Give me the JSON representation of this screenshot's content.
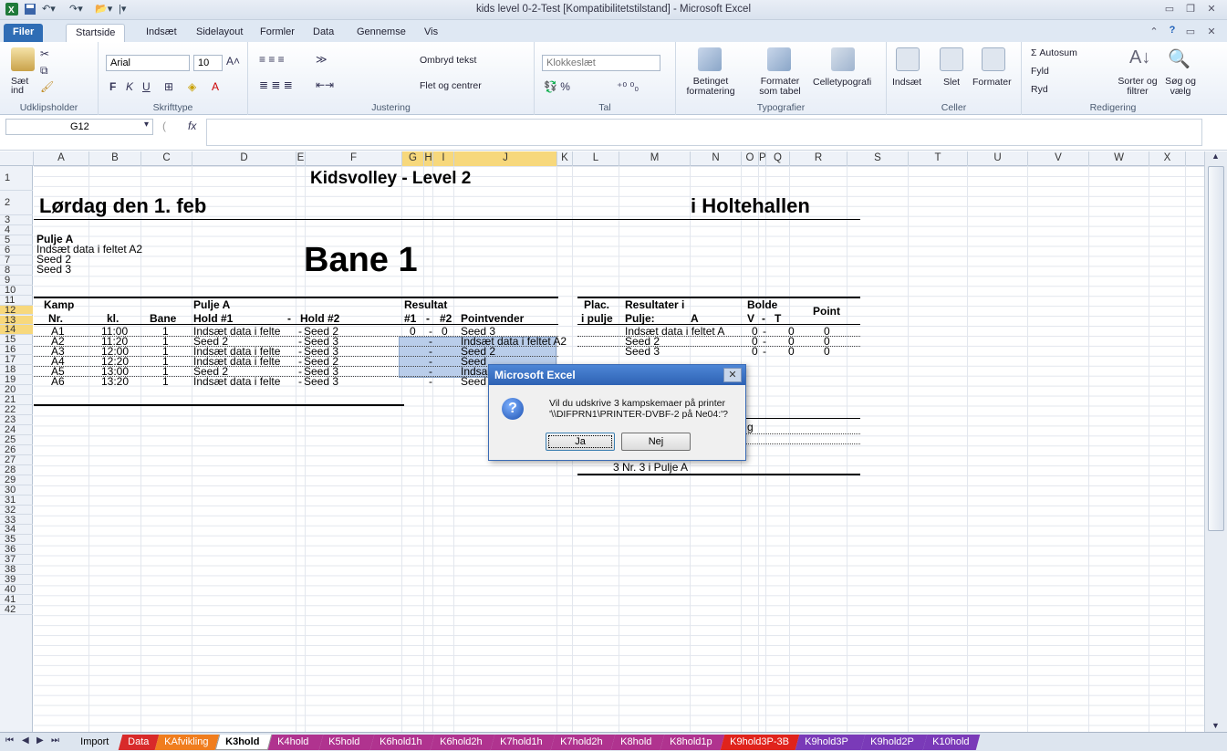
{
  "window": {
    "title": "kids level 0-2-Test  [Kompatibilitetstilstand]  -  Microsoft Excel"
  },
  "tabs": [
    "Filer",
    "Startside",
    "Indsæt",
    "Sidelayout",
    "Formler",
    "Data",
    "Gennemse",
    "Vis"
  ],
  "ribbon": {
    "clipboard": {
      "paste": "Sæt ind",
      "label": "Udklipsholder"
    },
    "font": {
      "name": "Arial",
      "size": "10",
      "label": "Skrifttype"
    },
    "align": {
      "wrap": "Ombryd tekst",
      "merge": "Flet og centrer",
      "label": "Justering"
    },
    "number": {
      "format": "Klokkeslæt",
      "label": "Tal"
    },
    "styles": {
      "cond": "Betinget formatering",
      "table": "Formater som tabel",
      "cell": "Celletypografi",
      "label": "Typografier"
    },
    "cells": {
      "insert": "Indsæt",
      "delete": "Slet",
      "format": "Formater",
      "label": "Celler"
    },
    "editing": {
      "autosum": "Σ Autosum",
      "fill": "Fyld",
      "clear": "Ryd",
      "sort": "Sorter og filtrer",
      "find": "Søg og vælg",
      "label": "Redigering"
    }
  },
  "formula": {
    "cell": "G12",
    "fx": "fx"
  },
  "columns": [
    "A",
    "B",
    "C",
    "D",
    "E",
    "F",
    "G",
    "H",
    "I",
    "J",
    "K",
    "L",
    "M",
    "N",
    "O",
    "P",
    "Q",
    "R",
    "S",
    "T",
    "U",
    "V",
    "W",
    "X"
  ],
  "rows": [
    "1",
    "2",
    "3",
    "4",
    "5",
    "6",
    "7",
    "8",
    "9",
    "10",
    "11",
    "12",
    "13",
    "14",
    "15",
    "16",
    "17",
    "18",
    "19",
    "20",
    "21",
    "22",
    "23",
    "24",
    "25",
    "26",
    "27",
    "28",
    "29",
    "30",
    "31",
    "32",
    "33",
    "34",
    "35",
    "36",
    "37",
    "38",
    "39",
    "40",
    "41",
    "42"
  ],
  "sheet": {
    "title": "Kidsvolley   -   Level 2",
    "date": "Lørdag den 1. feb",
    "place": "i  Holtehallen",
    "court": "Bane 1",
    "pool": "Pulje A",
    "pool_lines": [
      "Indsæt data i feltet A2",
      "Seed 2",
      "Seed 3"
    ],
    "hdr1": {
      "kamp": "Kamp",
      "pulje": "Pulje A",
      "resultat": "Resultat",
      "plac": "Plac.",
      "res_i": "Resultater i",
      "bolde": "Bolde",
      "point": "Point"
    },
    "hdr2": {
      "nr": "Nr.",
      "kl": "kl.",
      "bane": "Bane",
      "hold1": "Hold #1",
      "dash": "-",
      "hold2": "Hold #2",
      "r1": "#1",
      "rdash": "-",
      "r2": "#2",
      "pv": "Pointvender",
      "ipulje": "i pulje",
      "pulje": "Pulje:",
      "a": "A",
      "v": "V",
      "vdash": "-",
      "tcol": "T"
    },
    "matches": [
      {
        "nr": "A1",
        "kl": "11:00",
        "bane": "1",
        "h1": "Indsæt data i felte",
        "h2": "Seed 2",
        "r1": "0",
        "r2": "0",
        "pv": "Seed 3"
      },
      {
        "nr": "A2",
        "kl": "11:20",
        "bane": "1",
        "h1": "Seed 2",
        "h2": "Seed 3",
        "r1": "",
        "r2": "",
        "pv": "Indsæt data i feltet A2"
      },
      {
        "nr": "A3",
        "kl": "12:00",
        "bane": "1",
        "h1": "Indsæt data i felte",
        "h2": "Seed 3",
        "r1": "",
        "r2": "",
        "pv": "Seed 2"
      },
      {
        "nr": "A4",
        "kl": "12:20",
        "bane": "1",
        "h1": "Indsæt data i felte",
        "h2": "Seed 2",
        "r1": "",
        "r2": "",
        "pv": "Seed"
      },
      {
        "nr": "A5",
        "kl": "13:00",
        "bane": "1",
        "h1": "Seed 2",
        "h2": "Seed 3",
        "r1": "",
        "r2": "",
        "pv": "Indsa"
      },
      {
        "nr": "A6",
        "kl": "13:20",
        "bane": "1",
        "h1": "Indsæt data i felte",
        "h2": "Seed 3",
        "r1": "",
        "r2": "",
        "pv": "Seed"
      }
    ],
    "standings": [
      {
        "team": "Indsæt data i feltet A",
        "v": "0",
        "t": "0",
        "p": "0"
      },
      {
        "team": "Seed 2",
        "v": "0",
        "t": "0",
        "p": "0"
      },
      {
        "team": "Seed 3",
        "v": "0",
        "t": "0",
        "p": "0"
      }
    ],
    "final_line": "3 Nr. 3 i Pulje A",
    "partial": "g"
  },
  "dialog": {
    "title": "Microsoft Excel",
    "line1": "Vil du udskrive 3 kampskemaer på printer",
    "line2": "'\\\\DIFPRN1\\PRINTER-DVBF-2 på Ne04:'?",
    "yes": "Ja",
    "no": "Nej"
  },
  "sheet_tabs": [
    {
      "name": "Import",
      "color": "#dde5ef"
    },
    {
      "name": "Data",
      "color": "#d82a2a"
    },
    {
      "name": "KAfvikling",
      "color": "#f07d1e"
    },
    {
      "name": "K3hold",
      "color": "#ffffff"
    },
    {
      "name": "K4hold",
      "color": "#b0338f"
    },
    {
      "name": "K5hold",
      "color": "#b0338f"
    },
    {
      "name": "K6hold1h",
      "color": "#b0338f"
    },
    {
      "name": "K6hold2h",
      "color": "#b0338f"
    },
    {
      "name": "K7hold1h",
      "color": "#b0338f"
    },
    {
      "name": "K7hold2h",
      "color": "#b0338f"
    },
    {
      "name": "K8hold",
      "color": "#b0338f"
    },
    {
      "name": "K8hold1p",
      "color": "#b0338f"
    },
    {
      "name": "K9hold3P-3B",
      "color": "#e0231c"
    },
    {
      "name": "K9hold3P",
      "color": "#7a3ab8"
    },
    {
      "name": "K9hold2P",
      "color": "#7a3ab8"
    },
    {
      "name": "K10hold",
      "color": "#7a3ab8"
    }
  ]
}
